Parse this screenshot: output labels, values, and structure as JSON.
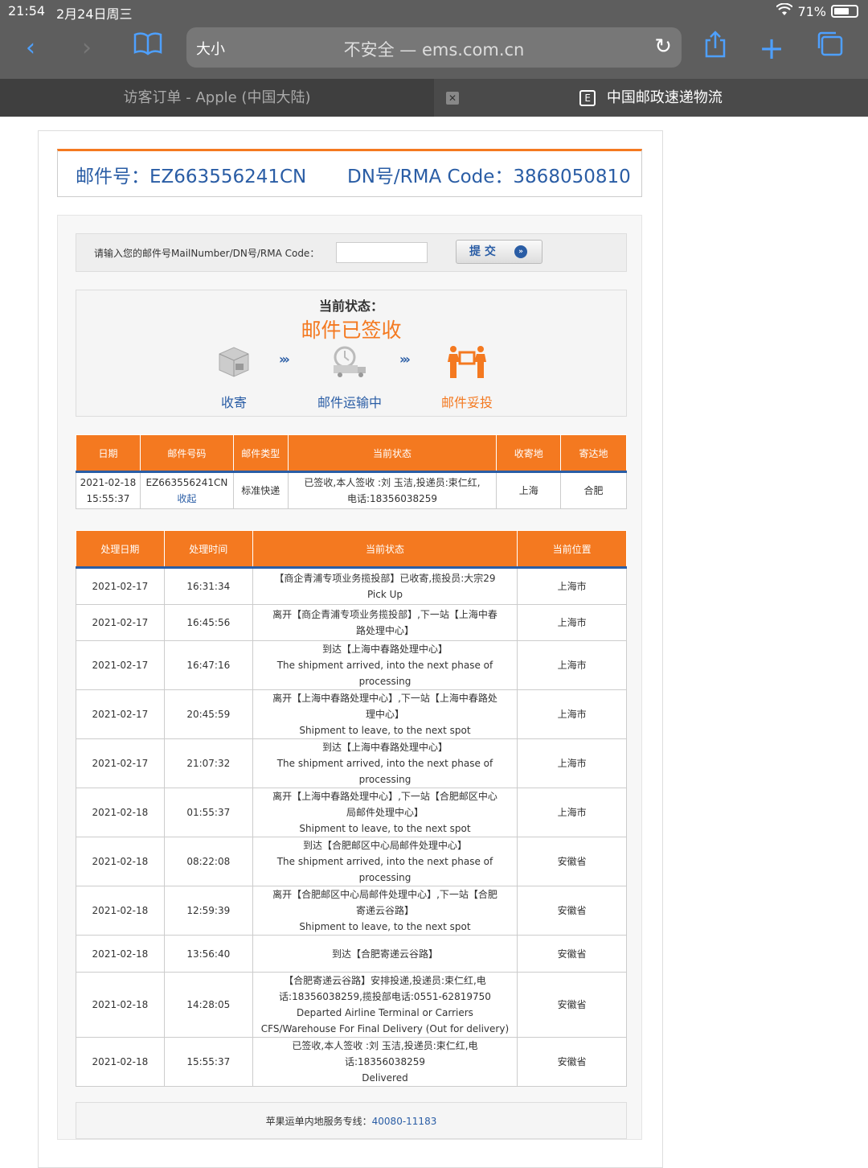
{
  "status_bar": {
    "time": "21:54",
    "date": "2月24日周三",
    "battery": "71%",
    "battery_level": 0.71
  },
  "browser": {
    "text_size_label": "大小",
    "url": "不安全 — ems.com.cn",
    "tabs": [
      {
        "title": "访客订单 - Apple (中国大陆)"
      },
      {
        "title": "中国邮政速递物流",
        "favicon": "E"
      }
    ]
  },
  "header": {
    "mail_number": "邮件号：EZ663556241CN",
    "dn_code": "DN号/RMA Code：3868050810"
  },
  "search": {
    "label": "请输入您的邮件号MailNumber/DN号/RMA Code：",
    "input_value": "",
    "submit_label": "提 交"
  },
  "status": {
    "title": "当前状态：",
    "current": "邮件已签收",
    "steps": [
      "收寄",
      "邮件运输中",
      "邮件妥投"
    ]
  },
  "summary_table": {
    "headers": [
      "日期",
      "邮件号码",
      "邮件类型",
      "当前状态",
      "收寄地",
      "寄达地"
    ],
    "row": {
      "date": "2021-02-18",
      "time": "15:55:37",
      "mail_no": "EZ663556241CN",
      "collapse_link": "收起",
      "type": "标准快递",
      "status_line1": "已签收,本人签收 :刘 玉洁,投递员:束仁红,",
      "status_line2": "电话:18356038259",
      "origin": "上海",
      "destination": "合肥"
    }
  },
  "details_table": {
    "headers": [
      "处理日期",
      "处理时间",
      "当前状态",
      "当前位置"
    ],
    "rows": [
      {
        "date": "2021-02-17",
        "time": "16:31:34",
        "status": [
          "【商企青浦专项业务揽投部】已收寄,揽投员:大宗29",
          "Pick Up"
        ],
        "location": "上海市"
      },
      {
        "date": "2021-02-17",
        "time": "16:45:56",
        "status": [
          "离开【商企青浦专项业务揽投部】,下一站【上海中春",
          "路处理中心】"
        ],
        "location": "上海市"
      },
      {
        "date": "2021-02-17",
        "time": "16:47:16",
        "status": [
          "到达【上海中春路处理中心】",
          "The shipment arrived, into the next phase of",
          "processing"
        ],
        "location": "上海市"
      },
      {
        "date": "2021-02-17",
        "time": "20:45:59",
        "status": [
          "离开【上海中春路处理中心】,下一站【上海中春路处",
          "理中心】",
          "Shipment to leave, to the next spot"
        ],
        "location": "上海市"
      },
      {
        "date": "2021-02-17",
        "time": "21:07:32",
        "status": [
          "到达【上海中春路处理中心】",
          "The shipment arrived, into the next phase of",
          "processing"
        ],
        "location": "上海市"
      },
      {
        "date": "2021-02-18",
        "time": "01:55:37",
        "status": [
          "离开【上海中春路处理中心】,下一站【合肥邮区中心",
          "局邮件处理中心】",
          "Shipment to leave, to the next spot"
        ],
        "location": "上海市"
      },
      {
        "date": "2021-02-18",
        "time": "08:22:08",
        "status": [
          "到达【合肥邮区中心局邮件处理中心】",
          "The shipment arrived, into the next phase of",
          "processing"
        ],
        "location": "安徽省"
      },
      {
        "date": "2021-02-18",
        "time": "12:59:39",
        "status": [
          "离开【合肥邮区中心局邮件处理中心】,下一站【合肥",
          "寄递云谷路】",
          "Shipment to leave, to the next spot"
        ],
        "location": "安徽省"
      },
      {
        "date": "2021-02-18",
        "time": "13:56:40",
        "status": [
          "到达【合肥寄递云谷路】"
        ],
        "location": "安徽省"
      },
      {
        "date": "2021-02-18",
        "time": "14:28:05",
        "status": [
          "【合肥寄递云谷路】安排投递,投递员:束仁红,电",
          "话:18356038259,揽投部电话:0551-62819750",
          "Departed Airline Terminal or Carriers",
          "CFS/Warehouse For Final Delivery (Out for delivery)"
        ],
        "location": "安徽省"
      },
      {
        "date": "2021-02-18",
        "time": "15:55:37",
        "status": [
          "已签收,本人签收 :刘 玉洁,投递员:束仁红,电",
          "话:18356038259",
          "Delivered"
        ],
        "location": "安徽省"
      }
    ]
  },
  "footer": {
    "label": "苹果运单内地服务专线：",
    "phone": "40080-11183"
  },
  "colors": {
    "accent": "#f47920",
    "link": "#2a5da5"
  }
}
